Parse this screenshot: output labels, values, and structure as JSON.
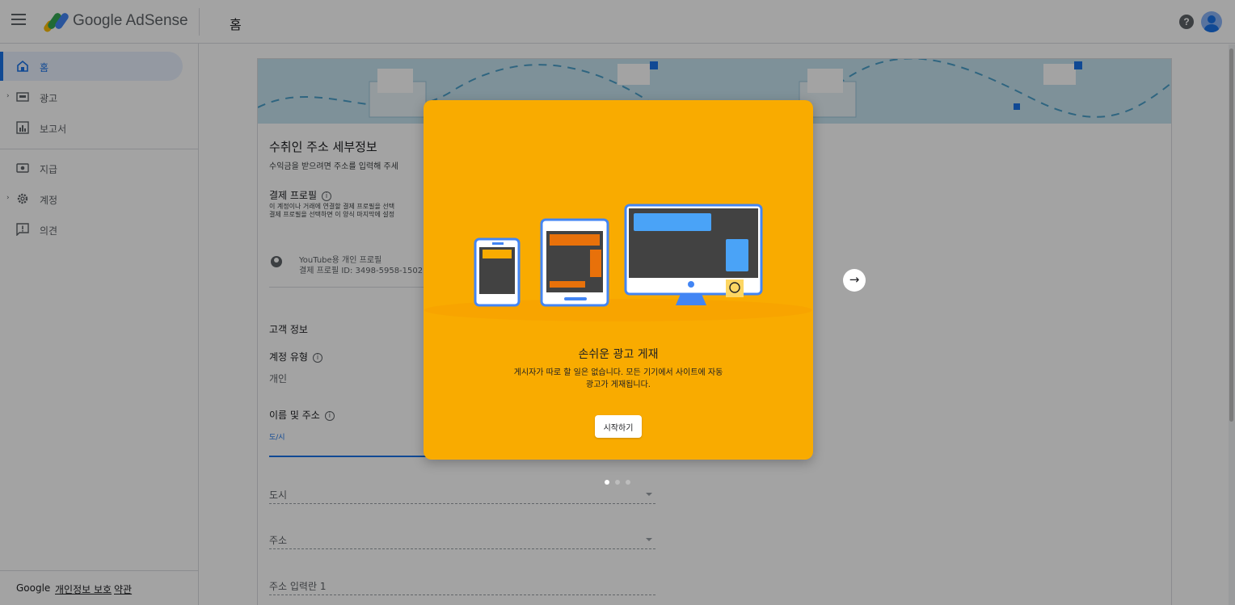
{
  "app": {
    "brand": "Google AdSense",
    "page_title": "홈"
  },
  "sidebar": {
    "items": [
      {
        "label": "홈",
        "icon": "home-icon",
        "active": true
      },
      {
        "label": "광고",
        "icon": "ads-icon"
      },
      {
        "label": "보고서",
        "icon": "reports-icon"
      },
      {
        "label": "지급",
        "icon": "payments-icon"
      },
      {
        "label": "계정",
        "icon": "gear-icon"
      },
      {
        "label": "의견",
        "icon": "feedback-icon"
      }
    ],
    "footer": {
      "brand": "Google",
      "privacy": "개인정보 보호",
      "terms": "약관"
    }
  },
  "form": {
    "title": "수취인 주소 세부정보",
    "subtitle": "수익금을 받으려면 주소를 입력해 주세",
    "payments_profile_label": "결제 프로필",
    "payments_profile_help_1": "이 계정이나 거래에 연결할 결제 프로필을 선택",
    "payments_profile_help_2": "결제 프로필을 선택하면 이 양식 마지막에 설정",
    "profile_name": "YouTube용 개인 프로필",
    "profile_id": "결제 프로필 ID: 3498-5958-1502",
    "customer_info": "고객 정보",
    "account_type_label": "계정 유형",
    "account_type_value": "개인",
    "name_address_label": "이름 및 주소",
    "city_small": "도/시",
    "city_dropdown": "도시",
    "address_dropdown": "주소",
    "address_line1": "주소 입력란 1"
  },
  "dialog": {
    "title": "손쉬운 광고 게재",
    "description_1": "게시자가 따로 할 일은 없습니다. 모든 기기에서 사이트에 자동",
    "description_2": "광고가 게재됩니다.",
    "start_button": "시작하기",
    "next_icon": "arrow-right-icon",
    "page_index": 1,
    "page_count": 3
  },
  "colors": {
    "dialog_bg": "#f9ab00",
    "accent": "#1a73e8",
    "banner": "#c5e3f0"
  }
}
